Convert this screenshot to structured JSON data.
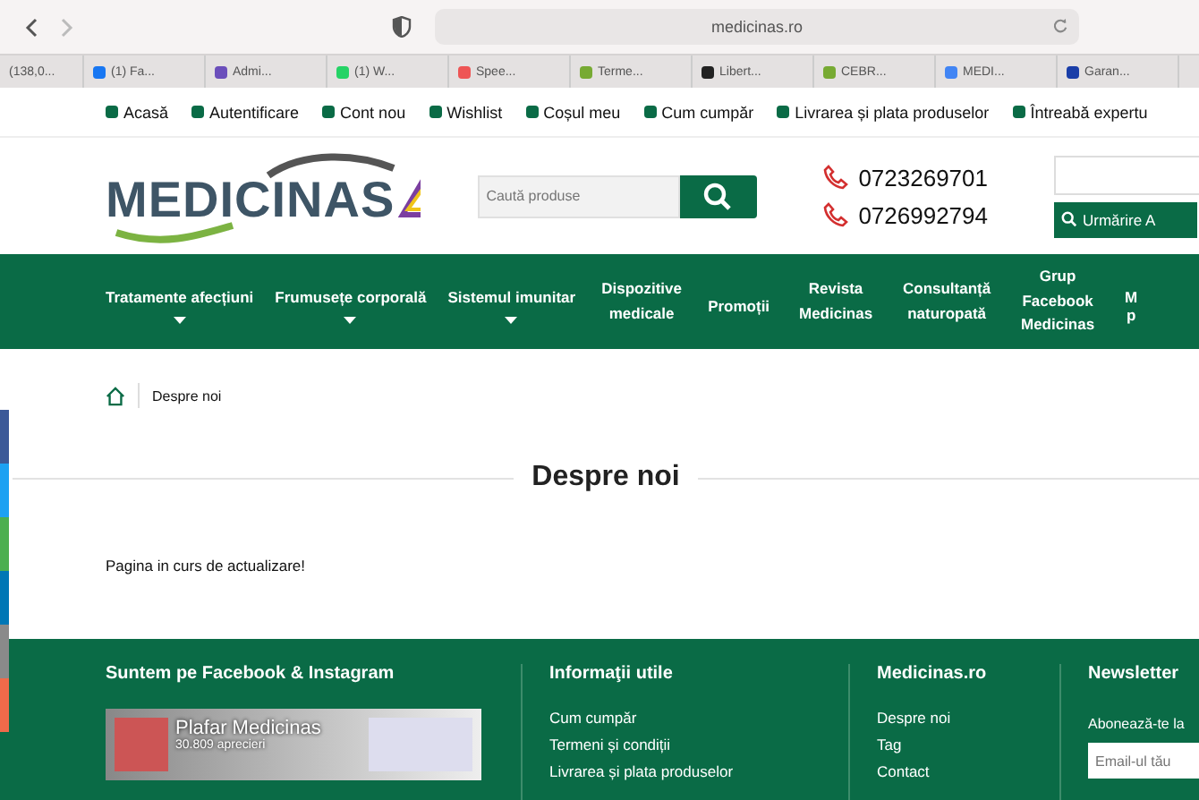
{
  "browser": {
    "url": "medicinas.ro",
    "tabs": [
      {
        "label": "(138,0...",
        "selected": false
      },
      {
        "label": "(1) Fa...",
        "selected": false
      },
      {
        "label": "Admi...",
        "selected": false
      },
      {
        "label": "(1) W...",
        "selected": false
      },
      {
        "label": "Spee...",
        "selected": false
      },
      {
        "label": "Terme...",
        "selected": false
      },
      {
        "label": "Libert...",
        "selected": false
      },
      {
        "label": "CEBR...",
        "selected": false
      },
      {
        "label": "MEDI...",
        "selected": false
      },
      {
        "label": "Garan...",
        "selected": false
      }
    ]
  },
  "top_links": [
    {
      "label": "Acasă"
    },
    {
      "label": "Autentificare"
    },
    {
      "label": "Cont nou"
    },
    {
      "label": "Wishlist"
    },
    {
      "label": "Coșul meu"
    },
    {
      "label": "Cum cumpăr"
    },
    {
      "label": "Livrarea și plata produselor"
    },
    {
      "label": "Întreabă expertu"
    }
  ],
  "header": {
    "logo": "MEDICINAS",
    "search": {
      "placeholder": "Caută produse"
    },
    "phones": [
      "0723269701",
      "0726992794"
    ],
    "tracking_button": "Urmărire A"
  },
  "nav": [
    {
      "label": "Tratamente afecțiuni",
      "has_dropdown": true
    },
    {
      "label": "Frumusețe corporală",
      "has_dropdown": true
    },
    {
      "label": "Sistemul imunitar",
      "has_dropdown": true
    },
    {
      "label": "Dispozitive medicale",
      "has_dropdown": false
    },
    {
      "label": "Promoții",
      "has_dropdown": false
    },
    {
      "label": "Revista Medicinas",
      "has_dropdown": false
    },
    {
      "label": "Consultanță naturopată",
      "has_dropdown": false
    },
    {
      "label": "Grup Facebook Medicinas",
      "has_dropdown": false
    },
    {
      "label": "M p",
      "has_dropdown": false
    }
  ],
  "breadcrumb": {
    "current": "Despre noi"
  },
  "page": {
    "title": "Despre noi",
    "text": "Pagina in curs de actualizare!"
  },
  "share_buttons": [
    {
      "color": "#3b5998"
    },
    {
      "color": "#1da1f2"
    },
    {
      "color": "#4caf50"
    },
    {
      "color": "#0077b5"
    },
    {
      "color": "#8a8a8a"
    },
    {
      "color": "#f06a4a"
    }
  ],
  "footer": {
    "facebook": {
      "title": "Suntem pe Facebook & Instagram",
      "page_name": "Plafar Medicinas",
      "likes": "30.809 aprecieri"
    },
    "info": {
      "title": "Informaţii utile",
      "links": [
        "Cum cumpăr",
        "Termeni și condiții",
        "Livrarea și plata produselor"
      ]
    },
    "site": {
      "title": "Medicinas.ro",
      "links": [
        "Despre noi",
        "Tag",
        "Contact"
      ]
    },
    "newsletter": {
      "title": "Newsletter",
      "text": "Abonează-te la",
      "placeholder": "Email-ul tău"
    }
  }
}
